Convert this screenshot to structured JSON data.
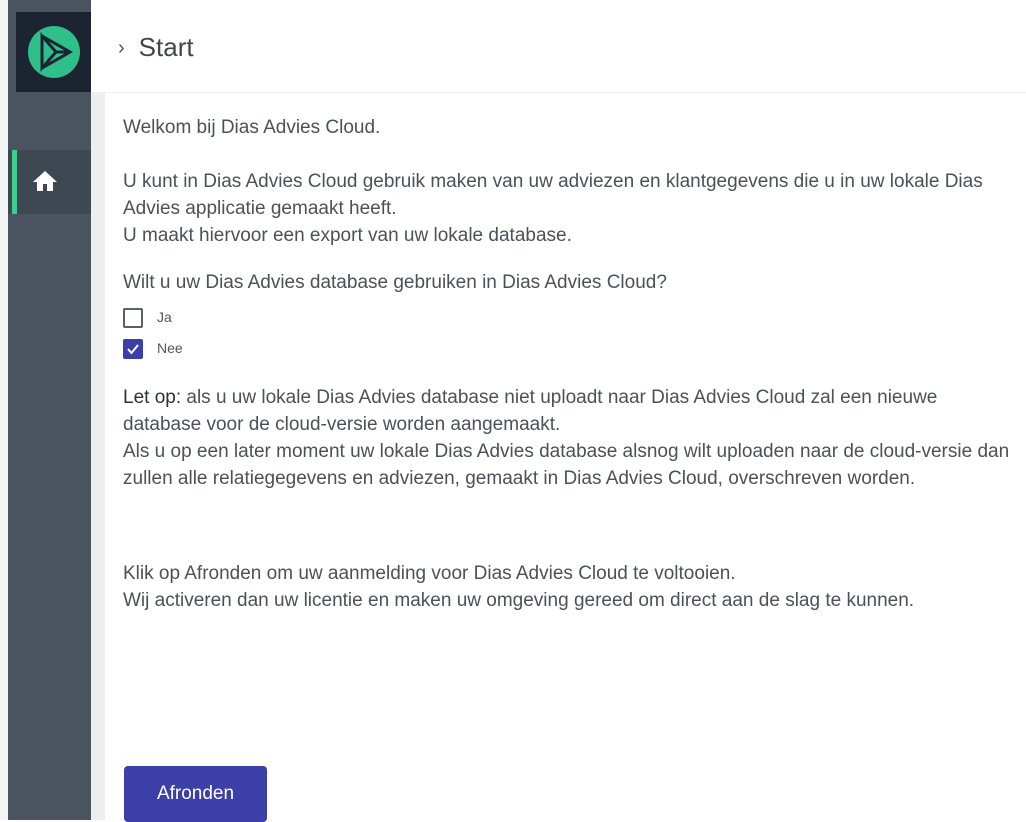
{
  "header": {
    "breadcrumb_title": "Start"
  },
  "sidebar": {
    "items": [
      {
        "name": "home"
      }
    ]
  },
  "main": {
    "welcome": "Welkom bij Dias Advies Cloud.",
    "intro_1": "U kunt in Dias Advies Cloud gebruik maken van uw adviezen en klantgegevens die u in uw lokale Dias Advies applicatie gemaakt heeft.",
    "intro_2": "U maakt hiervoor een export van uw lokale database.",
    "question": "Wilt u uw Dias Advies database gebruiken in Dias Advies Cloud?",
    "options": [
      {
        "label": "Ja",
        "checked": false
      },
      {
        "label": "Nee",
        "checked": true
      }
    ],
    "note_label": "Let op:",
    "note_text": " als u uw lokale Dias Advies database niet uploadt naar Dias Advies Cloud zal een nieuwe database voor de cloud-versie worden aangemaakt.",
    "note_text_2": "Als u op een later moment uw lokale Dias Advies database alsnog wilt uploaden naar de cloud-versie dan zullen alle relatiegegevens en adviezen, gemaakt in Dias Advies Cloud, overschreven worden.",
    "final_1": "Klik op Afronden om uw aanmelding voor Dias Advies Cloud te voltooien.",
    "final_2": "Wij activeren dan uw licentie en maken uw omgeving gereed om direct aan de slag te kunnen.",
    "button_label": "Afronden"
  },
  "colors": {
    "accent": "#3d3fa8",
    "sidebar": "#4a5460",
    "active_indicator": "#3ecf8e"
  }
}
